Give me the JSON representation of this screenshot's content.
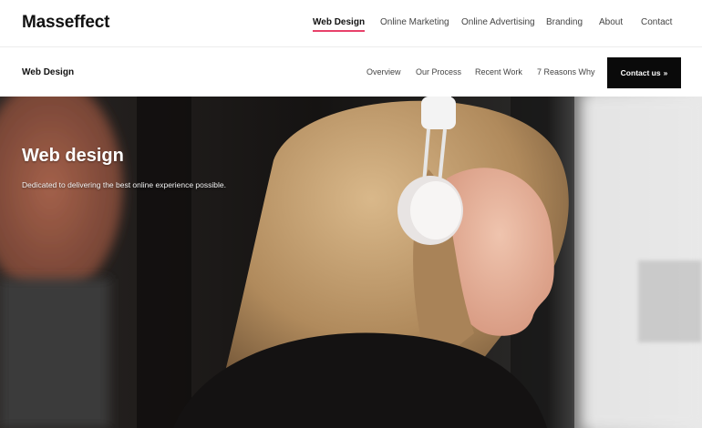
{
  "header": {
    "logo": "Masseffect",
    "nav": [
      {
        "label": "Web Design",
        "active": true
      },
      {
        "label": "Online Marketing",
        "active": false
      },
      {
        "label": "Online Advertising",
        "active": false
      },
      {
        "label": "Branding",
        "active": false
      },
      {
        "label": "About",
        "active": false
      },
      {
        "label": "Contact",
        "active": false
      }
    ],
    "active_underline_color": "#e8416a"
  },
  "subheader": {
    "title": "Web Design",
    "nav": [
      {
        "label": "Overview"
      },
      {
        "label": "Our Process"
      },
      {
        "label": "Recent Work"
      },
      {
        "label": "7 Reasons Why"
      }
    ],
    "cta_label": "Contact us",
    "cta_icon": "double-chevron-right-icon",
    "cta_color": "#0a0a0a"
  },
  "hero": {
    "title": "Web design",
    "subtitle": "Dedicated to delivering the best online experience possible.",
    "image": "photo-woman-with-headphones"
  }
}
